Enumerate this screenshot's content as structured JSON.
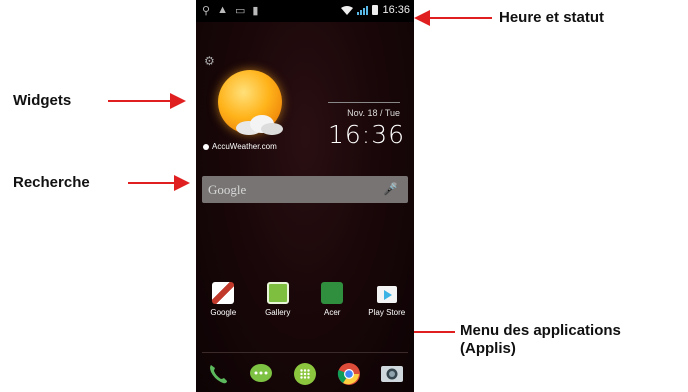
{
  "callouts": {
    "status": "Heure et statut",
    "widgets": "Widgets",
    "search": "Recherche",
    "menu_line1": "Menu des applications",
    "menu_line2": "(Applis)"
  },
  "status_bar": {
    "time": "16:36",
    "left_icons": [
      "usb-icon",
      "warning-icon",
      "image-icon",
      "sd-card-icon"
    ],
    "right_icons": [
      "wifi-icon",
      "signal-icon",
      "battery-icon"
    ]
  },
  "weather_widget": {
    "provider": "AccuWeather.com",
    "icon": "sun-cloud-icon"
  },
  "clock_widget": {
    "date": "Nov. 18 / Tue",
    "time": "16:36"
  },
  "search_bar": {
    "text": "Google",
    "icon": "microphone-icon"
  },
  "apps": [
    {
      "label": "Google",
      "icon": "gmail-icon",
      "color": "#c0392b"
    },
    {
      "label": "Gallery",
      "icon": "gallery-icon",
      "color": "#7fbf3f"
    },
    {
      "label": "Acer",
      "icon": "acer-cloud-icon",
      "color": "#2f8f3f"
    },
    {
      "label": "Play Store",
      "icon": "play-store-icon",
      "color": "#f4f4f4"
    }
  ],
  "dock": [
    {
      "icon": "phone-icon",
      "color": "#5cb85c"
    },
    {
      "icon": "messaging-icon",
      "color": "#7dc242"
    },
    {
      "icon": "app-drawer-icon",
      "color": "#8cc63f"
    },
    {
      "icon": "chrome-icon",
      "color": "#dd4b39"
    },
    {
      "icon": "camera-icon",
      "color": "#cfd8dc"
    }
  ],
  "colors": {
    "arrow": "#e02020",
    "search_bg": "#787474"
  }
}
